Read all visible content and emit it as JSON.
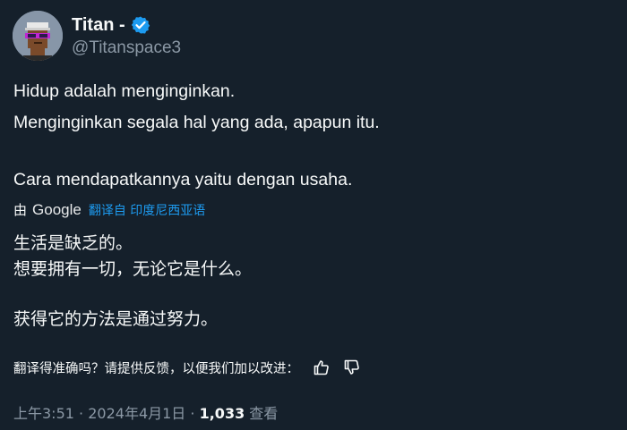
{
  "author": {
    "display_name": "Titan -",
    "handle": "@Titanspace3",
    "verified_icon": "verified-badge-icon",
    "avatar_icon": "pixel-punk-avatar"
  },
  "tweet": {
    "lines": [
      "Hidup adalah menginginkan.",
      "Menginginkan segala hal yang ada, apapun itu.",
      "Cara mendapatkannya yaitu dengan usaha."
    ]
  },
  "translation": {
    "by_label": "由",
    "provider": "Google",
    "translate_from": "翻译自 印度尼西亚语",
    "lines": [
      "生活是缺乏的。",
      "想要拥有一切，无论它是什么。",
      "获得它的方法是通过努力。"
    ],
    "feedback_prompt": "翻译得准确吗？请提供反馈，以便我们加以改进：",
    "thumbs_up_icon": "thumbs-up-icon",
    "thumbs_down_icon": "thumbs-down-icon"
  },
  "meta": {
    "time": "上午3:51",
    "separator": "·",
    "date": "2024年4月1日",
    "views_count": "1,033",
    "views_label": "查看"
  },
  "colors": {
    "background": "#15202b",
    "text": "#f7f9f9",
    "secondary": "#8b98a5",
    "accent": "#1d9bf0"
  }
}
